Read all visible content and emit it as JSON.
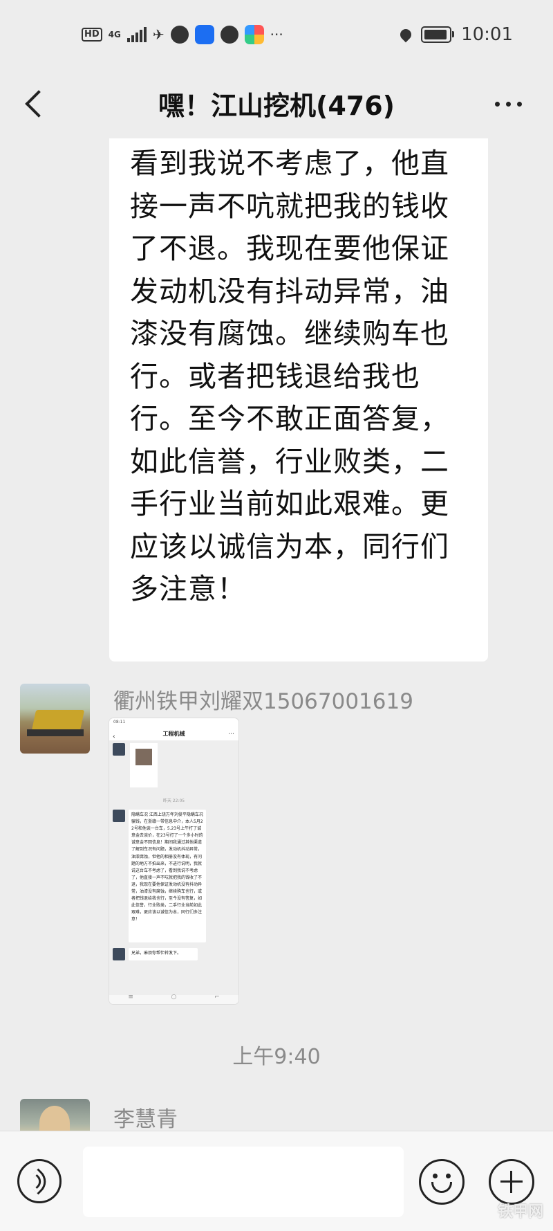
{
  "status_bar": {
    "hd": "HD",
    "network": "4G",
    "more": "···",
    "time": "10:01"
  },
  "header": {
    "title": "嘿！江山挖机(476)"
  },
  "message": {
    "text": "看到我说不考虑了，他直接一声不吭就把我的钱收了不退。我现在要他保证发动机没有抖动异常，油漆没有腐蚀。继续购车也行。或者把钱退给我也行。至今不敢正面答复，如此信誉，行业败类，二手行业当前如此艰难。更应该以诚信为本，同行们多注意！"
  },
  "sender1": {
    "name": "衢州铁甲刘耀双15067001619"
  },
  "forwarded_screenshot": {
    "status_time": "08:11",
    "title": "工程机械",
    "time_label": "昨天 22:05",
    "long_message": "隐瞒车况\n江西上饶万年刘俊平隐瞒车况骗钱，在浙赣一带信息中介，本人5月22号和他谈一台车，5.23号上午打了诚意金去谈价，在23号打了一个多小时的诚意金不回信息！期间我通过其他渠道了解到车况有问题，发动机抖动异常，油漆腐蚀，但他的相册没有体现，有问题的地方不拍出来，不进行说明，我就说这台车不考虑了，看到我说不考虑了，他直接一声不吭就把我的钱收了不退，我现在要他保证发动机没有抖动异常，油漆没有腐蚀，继续购车也行，或者把钱退给我也行，至今没有答复，如此信誉，行业败类，二手行业当前如此艰难，更应该以诚信为本，同行们多注意！",
    "short_message": "兄弟，麻烦你帮忙转发下。"
  },
  "timestamp": "上午9:40",
  "sender2": {
    "name": "李慧青"
  },
  "input_bar": {
    "placeholder": ""
  },
  "watermark": "铁甲网"
}
